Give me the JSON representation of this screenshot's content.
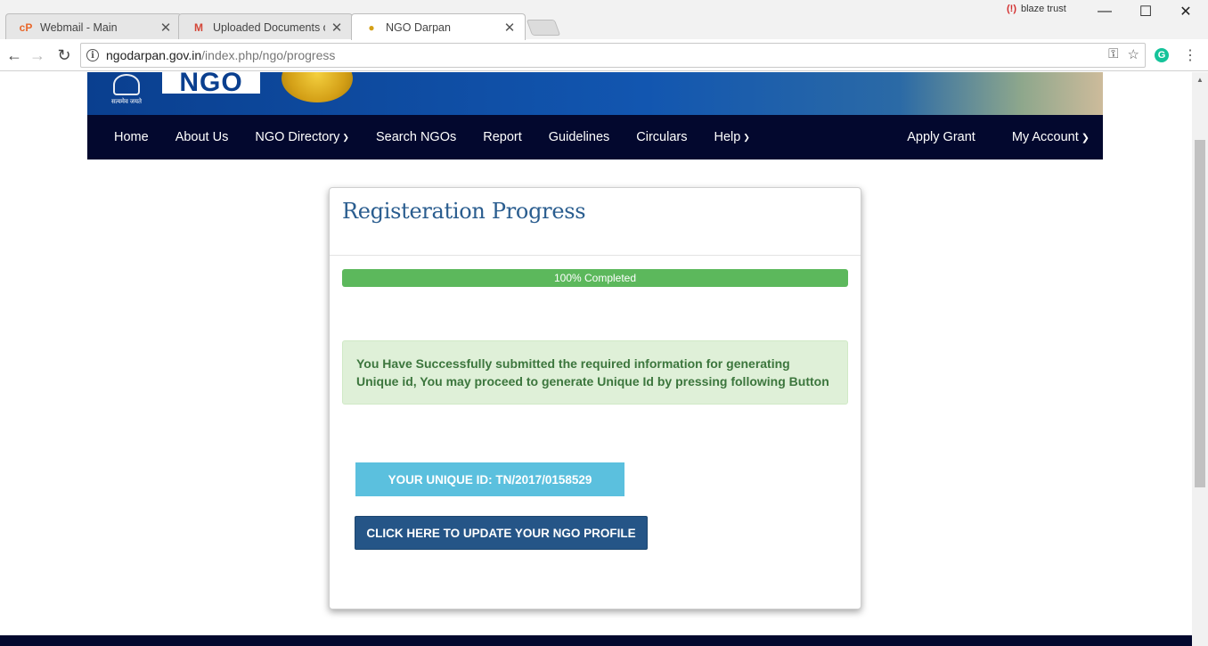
{
  "browser": {
    "tabs": [
      {
        "title": "Webmail - Main",
        "icon": "cpanel-icon",
        "icon_glyph": "cP",
        "icon_color": "#e8672b"
      },
      {
        "title": "Uploaded Documents of",
        "icon": "gmail-icon",
        "icon_glyph": "M",
        "icon_color": "#d44638"
      },
      {
        "title": "NGO Darpan",
        "icon": "darpan-favicon-icon",
        "icon_glyph": "●",
        "icon_color": "#d4a017"
      }
    ],
    "active_tab": 2,
    "close_glyph": "✕",
    "profile_name": "blaze trust",
    "url_host": "ngodarpan.gov.in",
    "url_path": "/index.php/ngo/progress"
  },
  "header": {
    "emblem_caption": "सत्यमेव जयते",
    "logo_text": "NGO"
  },
  "nav": {
    "left": [
      {
        "label": "Home",
        "dropdown": false
      },
      {
        "label": "About Us",
        "dropdown": false
      },
      {
        "label": "NGO Directory",
        "dropdown": true
      },
      {
        "label": "Search NGOs",
        "dropdown": false
      },
      {
        "label": "Report",
        "dropdown": false
      },
      {
        "label": "Guidelines",
        "dropdown": false
      },
      {
        "label": "Circulars",
        "dropdown": false
      },
      {
        "label": "Help",
        "dropdown": true
      }
    ],
    "right": [
      {
        "label": "Apply Grant",
        "dropdown": false
      },
      {
        "label": "My Account",
        "dropdown": true
      }
    ]
  },
  "panel": {
    "title": "Registeration Progress",
    "progress_percent": 100,
    "progress_label": "100% Completed",
    "progress_color": "#5cb85c",
    "alert_text": "You Have Successfully submitted the required information for generating Unique id, You may proceed to generate Unique Id by pressing following Button",
    "unique_id_label": "YOUR UNIQUE ID: TN/2017/0158529",
    "update_button_label": "CLICK HERE TO UPDATE YOUR NGO PROFILE"
  },
  "colors": {
    "nav_bg": "#03082e",
    "title_color": "#2a5d8f",
    "info_button": "#5bc0de",
    "primary_button": "#255587"
  }
}
